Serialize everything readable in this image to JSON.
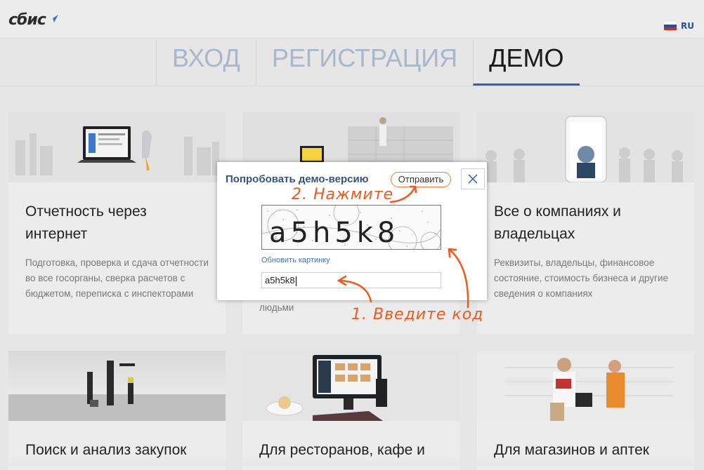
{
  "header": {
    "logo_text": "сбис",
    "lang_label": "RU",
    "flag_colors": [
      "#ffffff",
      "#1d4fb3",
      "#d52b1e"
    ]
  },
  "tabs": [
    {
      "label": "ВХОД",
      "active": false
    },
    {
      "label": "РЕГИСТРАЦИЯ",
      "active": false
    },
    {
      "label": "ДЕМО",
      "active": true
    }
  ],
  "cards": [
    {
      "title": "Отчетность через интернет",
      "desc": "Подготовка, проверка и сдача отчетности во все госорганы, сверка расчетов с бюджетом, переписка с инспекторами"
    },
    {
      "title": "",
      "desc": "людьми"
    },
    {
      "title": "Все о компаниях и владельцах",
      "desc": "Реквизиты, владельцы, финансовое состояние, стоимость бизнеса и другие сведения о компаниях"
    },
    {
      "title": "Поиск и анализ закупок",
      "desc": ""
    },
    {
      "title": "Для ресторанов, кафе и",
      "desc": ""
    },
    {
      "title": "Для магазинов и аптек",
      "desc": ""
    }
  ],
  "modal": {
    "title": "Попробовать демо-версию",
    "send_label": "Отправить",
    "captcha_text": "a5h5k8",
    "refresh_label": "Обновить картинку",
    "input_value": "a5h5k8"
  },
  "annotations": {
    "step2": "2. Нажмите",
    "step1": "1. Введите код"
  },
  "colors": {
    "accent_blue": "#2f63b0",
    "annotation_orange": "#ee5a1e",
    "button_border": "#f07a3c",
    "modal_title": "#34547f"
  }
}
